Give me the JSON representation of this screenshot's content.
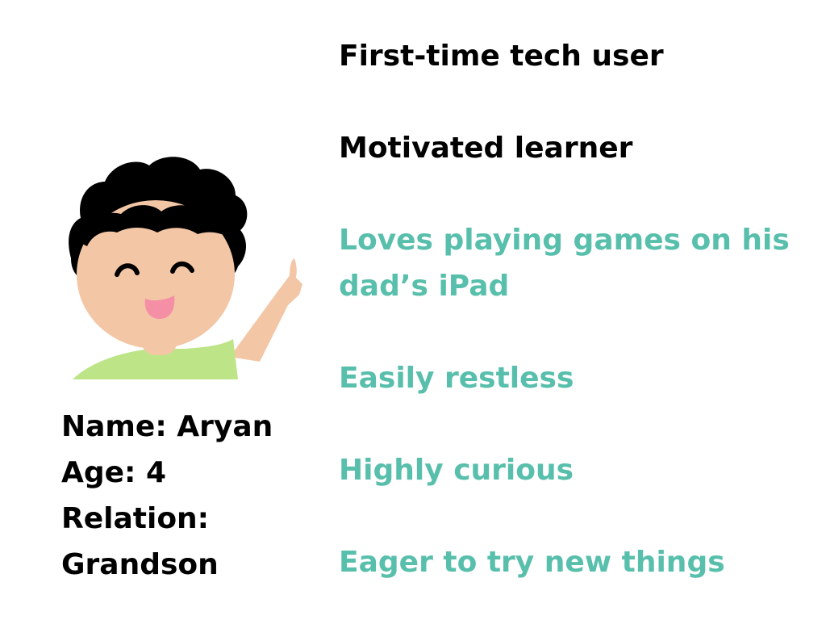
{
  "colors": {
    "primary_text": "#000000",
    "accent_text": "#57bfab",
    "skin": "#f3c6a5",
    "hair": "#000000",
    "shirt": "#bde588",
    "tongue": "#f48fa6"
  },
  "avatar": {
    "icon": "boy-waving-illustration"
  },
  "profile": {
    "name": "Name: Aryan",
    "age": "Age: 4",
    "relation_label": "Relation:",
    "relation_value": "Grandson"
  },
  "traits": [
    {
      "text": "First-time tech user",
      "color": "#000000"
    },
    {
      "text": "Motivated learner",
      "color": "#000000"
    },
    {
      "text": "Loves playing games on his dad’s iPad",
      "color": "#57bfab"
    },
    {
      "text": "Easily restless",
      "color": "#57bfab"
    },
    {
      "text": "Highly curious",
      "color": "#57bfab"
    },
    {
      "text": "Eager to try new things",
      "color": "#57bfab"
    }
  ]
}
